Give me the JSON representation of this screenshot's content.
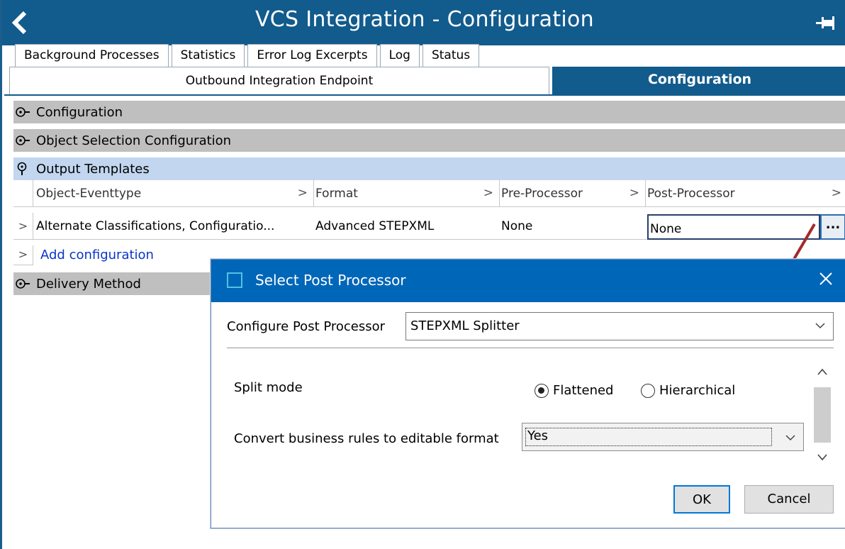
{
  "window": {
    "title": "VCS Integration - Configuration"
  },
  "tabs_top": [
    "Background Processes",
    "Statistics",
    "Error Log Excerpts",
    "Log",
    "Status"
  ],
  "tabs_main": {
    "left": "Outbound Integration Endpoint",
    "right": "Configuration"
  },
  "sections": {
    "configuration": "Configuration",
    "object_selection": "Object Selection Configuration",
    "output_templates": "Output Templates",
    "delivery_method": "Delivery Method"
  },
  "grid": {
    "headers": [
      "Object-Eventtype",
      "Format",
      "Pre-Processor",
      "Post-Processor"
    ],
    "row": {
      "object_eventtype": "Alternate Classifications, Configuratio...",
      "format": "Advanced STEPXML",
      "pre_processor": "None",
      "post_processor": "None",
      "ellipsis": "..."
    },
    "add_link": "Add configuration",
    "chevron": ">"
  },
  "dialog": {
    "title": "Select Post Processor",
    "configure_label": "Configure Post Processor",
    "configure_value": "STEPXML Splitter",
    "split_mode_label": "Split mode",
    "split_options": [
      "Flattened",
      "Hierarchical"
    ],
    "split_selected": "Flattened",
    "convert_label": "Convert business rules to editable format",
    "convert_value": "Yes",
    "ok": "OK",
    "cancel": "Cancel"
  },
  "colors": {
    "header_blue": "#125b8d",
    "dialog_title_blue": "#0066b8",
    "section_gray": "#bfbfbf",
    "section_blue": "#c2d6ef",
    "link_blue": "#0a35c8",
    "arrow_red": "#a32a2a"
  },
  "icons": [
    "back-chevron-icon",
    "pin-icon",
    "expand-circle-icon",
    "collapse-pin-icon",
    "close-icon",
    "dropdown-chevron-icon",
    "scroll-up-icon",
    "scroll-down-icon"
  ]
}
